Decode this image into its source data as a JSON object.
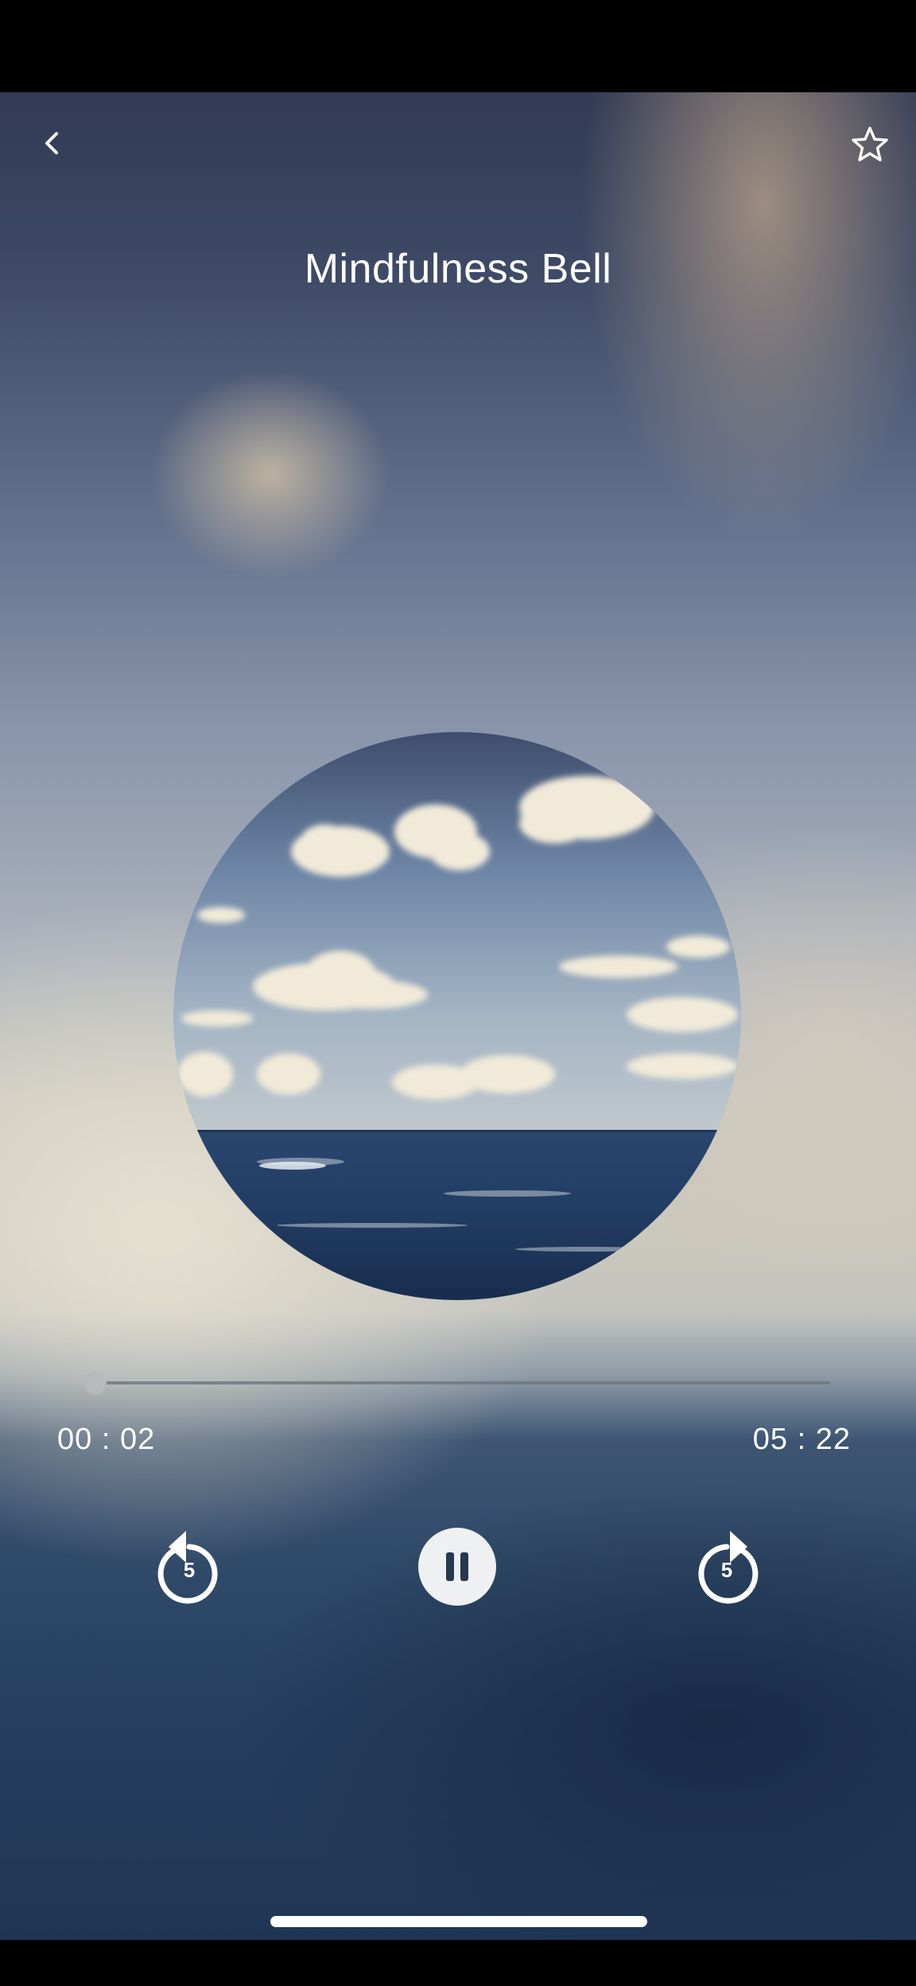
{
  "player": {
    "title": "Mindfulness Bell",
    "elapsed": "00 : 02",
    "total": "05 : 22",
    "progress": 0.006
  },
  "controls": {
    "rewind_seconds": "5",
    "forward_seconds": "5"
  },
  "icons": {
    "back": "chevron-left-icon",
    "favorite": "star-outline-icon",
    "rewind": "replay-5-icon",
    "pause": "pause-icon",
    "forward": "forward-5-icon"
  },
  "colors": {
    "text": "#ffffff",
    "pause_button": "#eef0f2",
    "pause_glyph": "#26384f"
  }
}
